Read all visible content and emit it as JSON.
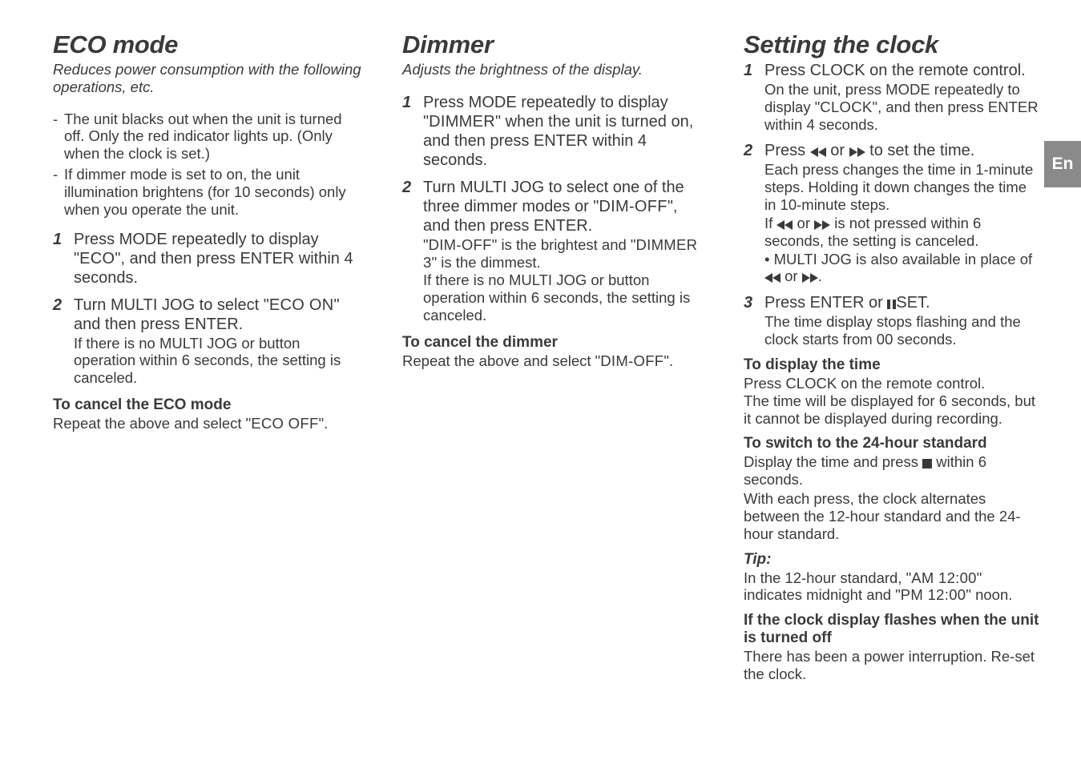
{
  "lang_tab": "En",
  "col1": {
    "heading": "ECO mode",
    "intro": "Reduces power consumption with the following operations, etc.",
    "dashes": [
      "The unit blacks out when the unit is turned off. Only the red indicator lights up. (Only when the clock is set.)",
      "If dimmer mode is set to on, the unit illumination brightens (for 10 seconds) only when you operate the unit."
    ],
    "steps": [
      {
        "main_pre": "Press MODE repeatedly to display \"",
        "main_disp": "ECO",
        "main_post": "\", and then press ENTER within 4 seconds."
      },
      {
        "main_pre": "Turn MULTI JOG to select \"",
        "main_disp": "ECO ON",
        "main_post": "\" and then press ENTER.",
        "desc": "If there is no MULTI JOG or button operation within 6 seconds, the setting is canceled."
      }
    ],
    "cancel_h": "To cancel the ECO mode",
    "cancel_p_pre": "Repeat the above and select \"",
    "cancel_p_disp": "ECO OFF",
    "cancel_p_post": "\"."
  },
  "col2": {
    "heading": "Dimmer",
    "intro": "Adjusts the brightness of the display.",
    "steps": [
      {
        "main_pre": "Press MODE repeatedly to display \"",
        "main_disp": "DIMMER",
        "main_post": "\" when the unit is turned on, and then press ENTER within 4 seconds."
      },
      {
        "main_pre": "Turn MULTI JOG to select one of the three dimmer modes or \"",
        "main_disp": "DIM-OFF",
        "main_post": "\", and then press ENTER.",
        "desc1_pre": "\"",
        "desc1_d1": "DIM-OFF",
        "desc1_mid": "\" is the brightest and \"",
        "desc1_d2": "DIMMER 3",
        "desc1_post": "\" is the dimmest.",
        "desc2": "If there is no MULTI JOG or button operation within 6 seconds, the setting is canceled."
      }
    ],
    "cancel_h": "To cancel the dimmer",
    "cancel_p_pre": "Repeat the above and select \"",
    "cancel_p_disp": "DIM-OFF",
    "cancel_p_post": "\"."
  },
  "col3": {
    "heading": "Setting the clock",
    "steps": [
      {
        "main": "Press CLOCK on the remote control.",
        "desc_pre": "On the unit, press MODE repeatedly to display \"",
        "desc_disp": "CLOCK",
        "desc_post": "\", and then press ENTER within 4 seconds."
      },
      {
        "main_pre": "Press ",
        "main_post": " to set the time.",
        "desc1": "Each press changes the time in 1-minute steps. Holding it down changes the time in 10-minute steps.",
        "desc2_pre": "If ",
        "desc2_post": " is not pressed within 6 seconds, the setting is canceled.",
        "desc3_pre": "• MULTI JOG is also available in place of ",
        "desc3_post": "."
      },
      {
        "main_pre": "Press ENTER or ",
        "main_post": "SET.",
        "desc": "The time display stops flashing and the clock starts from 00 seconds."
      }
    ],
    "disp_time_h": "To display the time",
    "disp_time_p": "Press CLOCK on the remote control.\nThe time will be displayed for 6 seconds, but it cannot be displayed during recording.",
    "std_h": "To switch to the 24-hour standard",
    "std_p1_pre": "Display the time and press ",
    "std_p1_post": " within 6 seconds.",
    "std_p2": "With each press, the clock alternates between the 12-hour standard and the 24-hour standard.",
    "tip_h": "Tip:",
    "tip_p_pre": "In the 12-hour standard, \"",
    "tip_d1": "AM 12:00",
    "tip_mid": "\" indicates midnight and \"",
    "tip_d2": "PM 12:00",
    "tip_post": "\" noon.",
    "flash_h": "If the clock display flashes when the unit is turned off",
    "flash_p": "There has been a power interruption. Re-set the clock."
  },
  "conjunction_or": " or "
}
